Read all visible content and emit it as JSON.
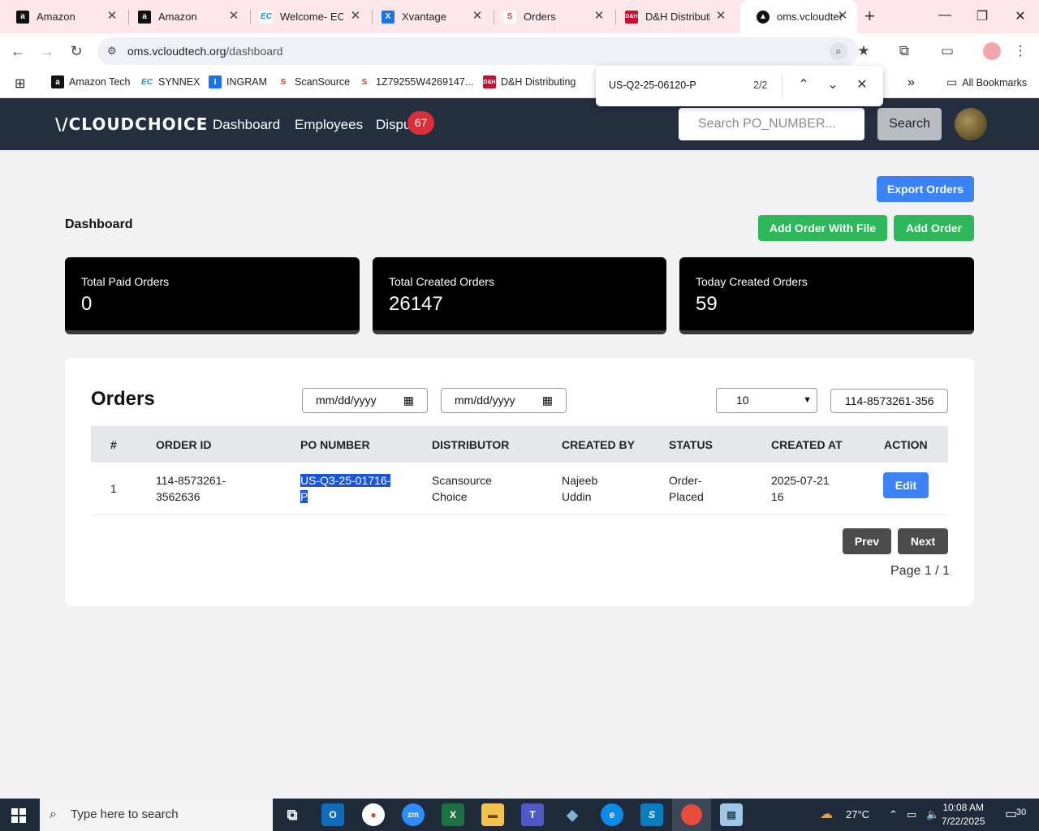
{
  "browser": {
    "tabs": [
      {
        "label": "Amazon",
        "icon": "amazon-icon"
      },
      {
        "label": "Amazon",
        "icon": "amazon-icon"
      },
      {
        "label": "Welcome- ECE",
        "icon": "ec-icon"
      },
      {
        "label": "Xvantage",
        "icon": "xvantage-icon"
      },
      {
        "label": "Orders",
        "icon": "scansource-icon"
      },
      {
        "label": "D&H Distributi",
        "icon": "dh-icon"
      },
      {
        "label": "oms.vcloudtec",
        "icon": "oms-icon"
      }
    ],
    "url_host": "oms.vcloudtech.org",
    "url_path": "/dashboard",
    "bookmarks": [
      {
        "label": "Amazon Tech"
      },
      {
        "label": "SYNNEX"
      },
      {
        "label": "INGRAM"
      },
      {
        "label": "ScanSource"
      },
      {
        "label": "1Z79255W4269147..."
      },
      {
        "label": "D&H Distributing"
      }
    ],
    "all_bookmarks": "All Bookmarks",
    "find": {
      "query": "US-Q2-25-06120-P",
      "count": "2/2"
    }
  },
  "app": {
    "logo": "\\/CLOUDCHOICE",
    "nav": [
      "Dashboard",
      "Employees",
      "Dispu"
    ],
    "disputes_badge": "67",
    "search_placeholder": "Search PO_NUMBER...",
    "search_button": "Search"
  },
  "dashboard": {
    "title": "Dashboard",
    "export_button": "Export Orders",
    "add_file_button": "Add Order With File",
    "add_button": "Add Order",
    "cards": [
      {
        "label": "Total Paid Orders",
        "value": "0"
      },
      {
        "label": "Total Created Orders",
        "value": "26147"
      },
      {
        "label": "Today Created Orders",
        "value": "59"
      }
    ]
  },
  "orders": {
    "title": "Orders",
    "date_from": "mm/dd/yyyy",
    "date_to": "mm/dd/yyyy",
    "page_size": "10",
    "filter_value": "114-8573261-356",
    "columns": [
      "#",
      "ORDER ID",
      "PO NUMBER",
      "DISTRIBUTOR",
      "CREATED BY",
      "STATUS",
      "CREATED AT",
      "ACTION"
    ],
    "rows": [
      {
        "num": "1",
        "order_id_1": "114-8573261-",
        "order_id_2": "3562636",
        "po_1": "US-Q3-25-01716-",
        "po_2": "P",
        "distributor_1": "Scansource",
        "distributor_2": "Choice",
        "created_by_1": "Najeeb",
        "created_by_2": "Uddin",
        "status_1": "Order-",
        "status_2": "Placed",
        "created_at_1": "2025-07-21",
        "created_at_2": "16",
        "action": "Edit"
      }
    ],
    "prev": "Prev",
    "next": "Next",
    "page_info": "Page 1 / 1"
  },
  "taskbar": {
    "search_placeholder": "Type here to search",
    "temperature": "27°C",
    "time": "10:08 AM",
    "date": "7/22/2025",
    "notifications": "30"
  }
}
